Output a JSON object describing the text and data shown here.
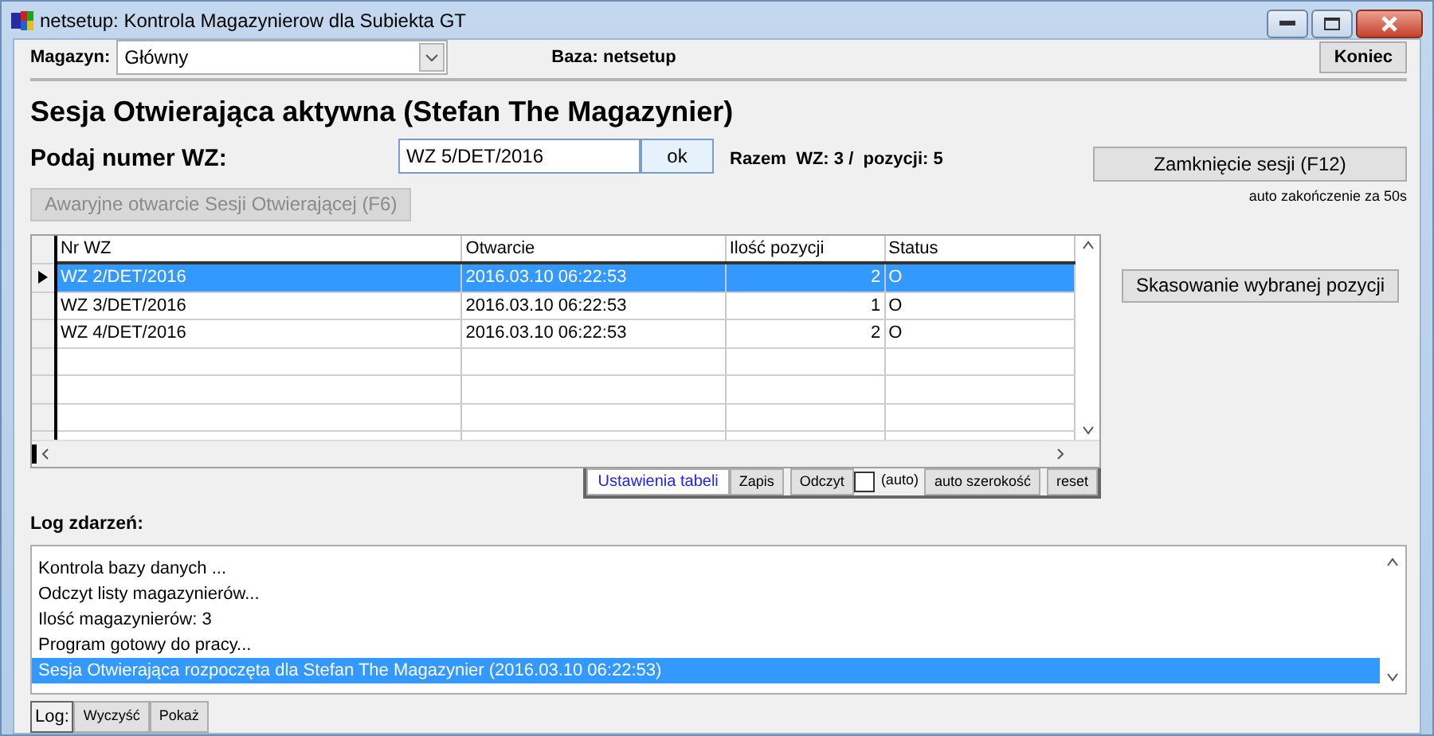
{
  "window": {
    "title": "netsetup: Kontrola Magazynierow dla Subiekta GT"
  },
  "toolbar": {
    "warehouse_label": "Magazyn:",
    "warehouse_value": "Główny",
    "database": "Baza: netsetup",
    "exit_button": "Koniec"
  },
  "session": {
    "heading": "Sesja Otwierająca aktywna (Stefan The Magazynier)",
    "prompt": "Podaj numer WZ:",
    "wz_value": "WZ 5/DET/2016",
    "ok_button": "ok",
    "totals": "Razem  WZ: 3 /  pozycji: 5",
    "close_button": "Zamknięcie sesji (F12)",
    "auto_close": "auto zakończenie za 50s",
    "emergency_button": {
      "label": "Awaryjne otwarcie Sesji Otwierającej (F6)",
      "disabled": true
    }
  },
  "table": {
    "columns": [
      "Nr WZ",
      "Otwarcie",
      "Ilość pozycji",
      "Status"
    ],
    "rows": [
      {
        "cells": [
          "WZ 2/DET/2016",
          "2016.03.10 06:22:53",
          "2",
          "O"
        ],
        "selected": true
      },
      {
        "cells": [
          "WZ 3/DET/2016",
          "2016.03.10 06:22:53",
          "1",
          "O"
        ],
        "selected": false
      },
      {
        "cells": [
          "WZ 4/DET/2016",
          "2016.03.10 06:22:53",
          "2",
          "O"
        ],
        "selected": false
      }
    ]
  },
  "table_toolbar": {
    "settings_link": "Ustawienia tabeli",
    "save_button": "Zapis",
    "read_button": "Odczyt",
    "auto_checkbox": {
      "label": "(auto)",
      "checked": false
    },
    "autowidth_button": "auto szerokość",
    "reset_button": "reset"
  },
  "delete_button": "Skasowanie wybranej pozycji",
  "log": {
    "title": "Log zdarzeń:",
    "entries": [
      {
        "text": "Kontrola bazy danych ...",
        "selected": false
      },
      {
        "text": "Odczyt listy magazynierów...",
        "selected": false
      },
      {
        "text": "Ilość magazynierów: 3",
        "selected": false
      },
      {
        "text": "Program gotowy do pracy...",
        "selected": false
      },
      {
        "text": "Sesja Otwierająca rozpoczęta dla Stefan The Magazynier (2016.03.10 06:22:53)",
        "selected": true
      }
    ]
  },
  "log_buttons": {
    "label": "Log:",
    "clear_button": "Wyczyść",
    "show_button": "Pokaż"
  }
}
